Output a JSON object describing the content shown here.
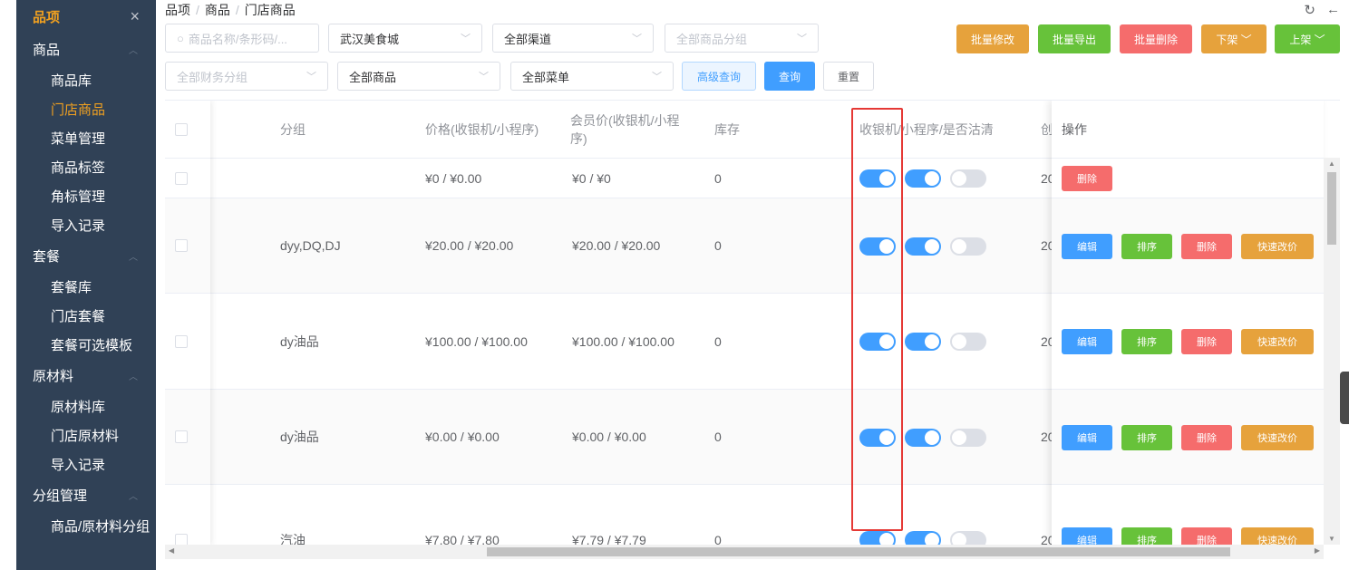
{
  "sidebar": {
    "title": "品项",
    "groups": [
      {
        "label": "商品",
        "items": [
          "商品库",
          "门店商品",
          "菜单管理",
          "商品标签",
          "角标管理",
          "导入记录"
        ]
      },
      {
        "label": "套餐",
        "items": [
          "套餐库",
          "门店套餐",
          "套餐可选模板"
        ]
      },
      {
        "label": "原材料",
        "items": [
          "原材料库",
          "门店原材料",
          "导入记录"
        ]
      },
      {
        "label": "分组管理",
        "items": [
          "商品/原材料分组"
        ]
      }
    ],
    "active_item": "门店商品"
  },
  "breadcrumb": [
    "品项",
    "商品",
    "门店商品"
  ],
  "filters": {
    "search_placeholder": "商品名称/条形码/...",
    "store": "武汉美食城",
    "channel": "全部渠道",
    "category_placeholder": "全部商品分组",
    "finance_placeholder": "全部财务分组",
    "product": "全部商品",
    "menu": "全部菜单",
    "advanced": "高级查询",
    "query": "查询",
    "reset": "重置"
  },
  "actions": {
    "batch_edit": "批量修改",
    "batch_export": "批量导出",
    "batch_delete": "批量删除",
    "off_shelf": "下架",
    "on_shelf": "上架"
  },
  "table": {
    "headers": {
      "group": "分组",
      "price": "价格(收银机/小程序)",
      "member_price": "会员价(收银机/小程序)",
      "stock": "库存",
      "switches": "收银机/小程序/是否沽清",
      "created": "创",
      "ops": "操作"
    },
    "rows": [
      {
        "group": "",
        "price": "¥0 / ¥0.00",
        "member_price": "¥0 / ¥0",
        "stock": "0",
        "created": "20",
        "pos": true,
        "mini": true,
        "sold_out": false,
        "ops": [
          "删除"
        ]
      },
      {
        "group": "dyy,DQ,DJ",
        "price": "¥20.00 / ¥20.00",
        "member_price": "¥20.00 / ¥20.00",
        "stock": "0",
        "created": "20",
        "pos": true,
        "mini": true,
        "sold_out": false,
        "ops": [
          "编辑",
          "排序",
          "删除",
          "快速改价"
        ]
      },
      {
        "group": "dy油品",
        "price": "¥100.00 / ¥100.00",
        "member_price": "¥100.00 / ¥100.00",
        "stock": "0",
        "created": "20",
        "pos": true,
        "mini": true,
        "sold_out": false,
        "ops": [
          "编辑",
          "排序",
          "删除",
          "快速改价"
        ]
      },
      {
        "group": "dy油品",
        "price": "¥0.00 / ¥0.00",
        "member_price": "¥0.00 / ¥0.00",
        "stock": "0",
        "created": "20",
        "pos": true,
        "mini": true,
        "sold_out": false,
        "ops": [
          "编辑",
          "排序",
          "删除",
          "快速改价"
        ]
      },
      {
        "group": "汽油",
        "price": "¥7.80 / ¥7.80",
        "member_price": "¥7.79 / ¥7.79",
        "stock": "0",
        "created": "20",
        "pos": true,
        "mini": true,
        "sold_out": false,
        "ops": [
          "编辑",
          "排序",
          "删除",
          "快速改价"
        ]
      }
    ]
  },
  "colors": {
    "sidebar_bg": "#304156",
    "active": "#f0a020",
    "primary": "#409eff",
    "success": "#67c23a",
    "danger": "#f56c6c",
    "warning": "#e6a23c",
    "highlight_box": "#e53935"
  }
}
